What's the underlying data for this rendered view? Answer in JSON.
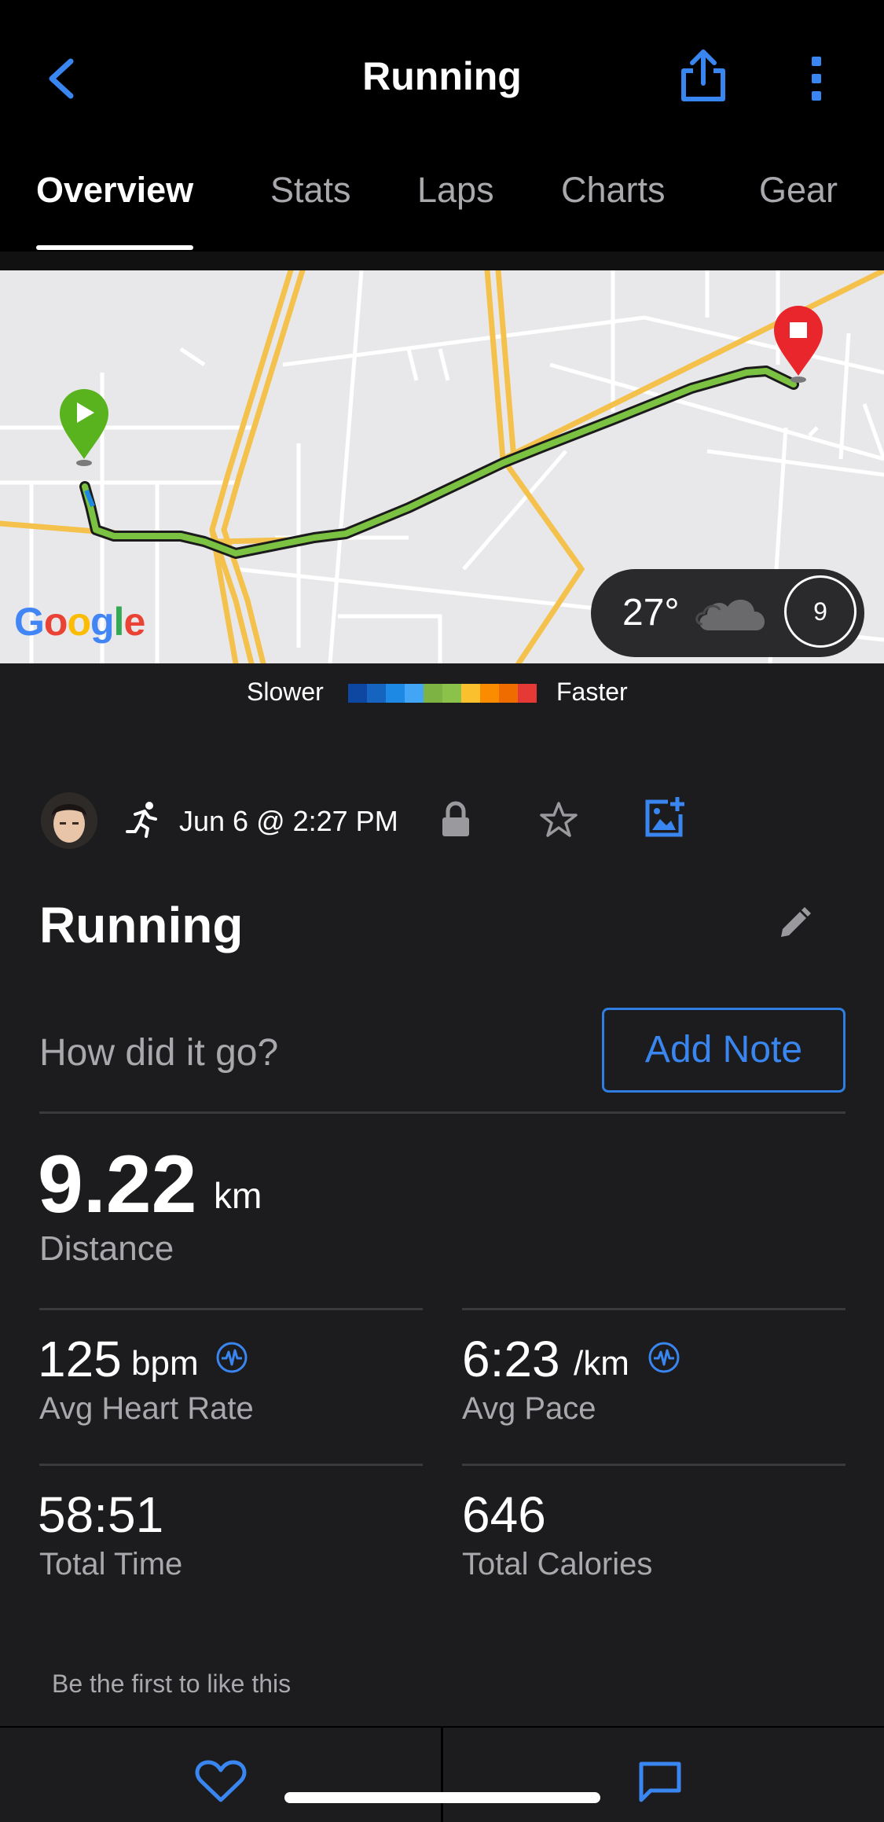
{
  "header": {
    "title": "Running",
    "back_icon": "chevron-left-icon",
    "share_icon": "share-icon",
    "more_icon": "more-vertical-icon"
  },
  "tabs": [
    {
      "label": "Overview",
      "active": true
    },
    {
      "label": "Stats",
      "active": false
    },
    {
      "label": "Laps",
      "active": false
    },
    {
      "label": "Charts",
      "active": false
    },
    {
      "label": "Gear",
      "active": false
    }
  ],
  "map": {
    "provider_logo": "Google",
    "weather": {
      "temperature": "27°",
      "condition_icon": "cloud-icon",
      "wind_speed": "9"
    }
  },
  "legend": {
    "slower": "Slower",
    "faster": "Faster",
    "colors": [
      "#0d47a1",
      "#1565c0",
      "#1e88e5",
      "#42a5f5",
      "#7cb342",
      "#8bc34a",
      "#fbc02d",
      "#fb8c00",
      "#ef6c00",
      "#e53935"
    ]
  },
  "activity": {
    "date": "Jun 6 @ 2:27 PM",
    "type_icon": "running-icon",
    "name": "Running",
    "note_prompt": "How did it go?",
    "add_note_label": "Add Note"
  },
  "stats": {
    "distance": {
      "value": "9.22",
      "unit": "km",
      "label": "Distance"
    },
    "heart_rate": {
      "value": "125",
      "unit": "bpm",
      "label": "Avg Heart Rate"
    },
    "pace": {
      "value": "6:23",
      "unit": "/km",
      "label": "Avg Pace"
    },
    "time": {
      "value": "58:51",
      "label": "Total Time"
    },
    "calories": {
      "value": "646",
      "label": "Total Calories"
    }
  },
  "social": {
    "likes_text": "Be the first to like this"
  },
  "colors": {
    "accent": "#3a86f0",
    "route": "#7cc242",
    "start_pin": "#58b31e",
    "end_pin": "#e8262c"
  }
}
